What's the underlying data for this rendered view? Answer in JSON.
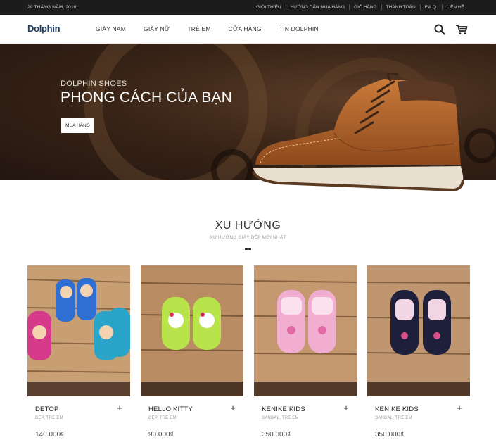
{
  "topbar": {
    "date": "29 THÁNG NĂM, 2016",
    "links": [
      "GIỚI THIỆU",
      "HƯỚNG DẪN MUA HÀNG",
      "GIỎ HÀNG",
      "THANH TOÁN",
      "F.A.Q.",
      "LIÊN HỆ"
    ]
  },
  "header": {
    "logo": "Dolphin",
    "nav": [
      "GIÀY NAM",
      "GIÀY NỮ",
      "TRẺ EM",
      "CỬA HÀNG",
      "TIN DOLPHIN"
    ],
    "icons": [
      "search-icon",
      "cart-icon"
    ]
  },
  "hero": {
    "subtitle": "DOLPHIN SHOES",
    "title": "PHONG CÁCH CỦA BẠN",
    "button": "MUA HÀNG"
  },
  "section": {
    "title": "XU HƯỚNG",
    "subtitle": "XU HƯỚNG GIÀY DÉP MỚI NHẤT"
  },
  "products": [
    {
      "name": "DETOP",
      "category": "DÉP, TRẺ EM",
      "price": "140.000₫"
    },
    {
      "name": "HELLO KITTY",
      "category": "DÉP, TRẺ EM",
      "price": "90.000₫"
    },
    {
      "name": "KENIKE KIDS",
      "category": "SANDAL, TRẺ EM",
      "price": "350.000₫"
    },
    {
      "name": "KENIKE KIDS",
      "category": "SANDAL, TRẺ EM",
      "price": "350.000₫"
    }
  ],
  "colors": {
    "topbar_bg": "#1c1c1c",
    "logo": "#1f3b5e",
    "hero_bg": "#3a2517",
    "boot": "#b5652c"
  }
}
